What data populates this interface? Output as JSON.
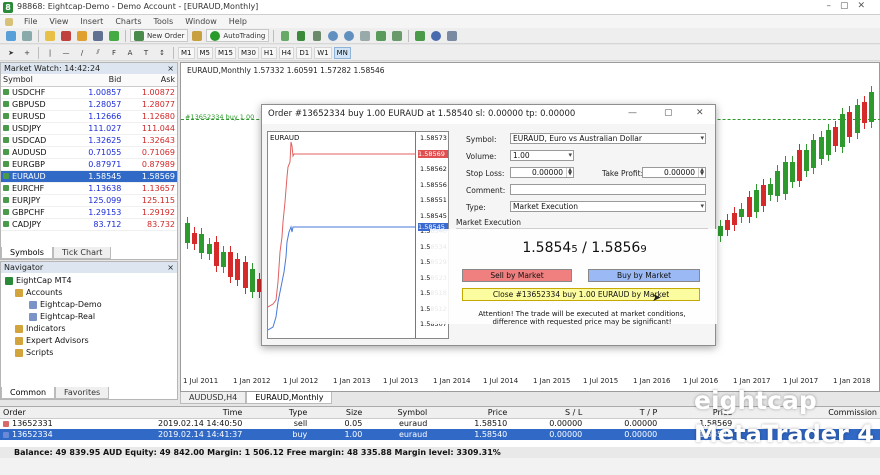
{
  "window": {
    "title": "98868: Eightcap-Demo - Demo Account - [EURAUD,Monthly]"
  },
  "menu": [
    "File",
    "View",
    "Insert",
    "Charts",
    "Tools",
    "Window",
    "Help"
  ],
  "toolbar": {
    "new_order": "New Order",
    "autotrading": "AutoTrading",
    "periods": [
      "M1",
      "M5",
      "M15",
      "M30",
      "H1",
      "H4",
      "D1",
      "W1",
      "MN"
    ],
    "active_period": "MN"
  },
  "market_watch": {
    "title": "Market Watch: 14:42:24",
    "columns": [
      "Symbol",
      "Bid",
      "Ask"
    ],
    "rows": [
      {
        "symbol": "USDCHF",
        "bid": "1.00857",
        "ask": "1.00872"
      },
      {
        "symbol": "GBPUSD",
        "bid": "1.28057",
        "ask": "1.28077"
      },
      {
        "symbol": "EURUSD",
        "bid": "1.12666",
        "ask": "1.12680"
      },
      {
        "symbol": "USDJPY",
        "bid": "111.027",
        "ask": "111.044"
      },
      {
        "symbol": "USDCAD",
        "bid": "1.32625",
        "ask": "1.32643"
      },
      {
        "symbol": "AUDUSD",
        "bid": "0.71055",
        "ask": "0.71069"
      },
      {
        "symbol": "EURGBP",
        "bid": "0.87971",
        "ask": "0.87989"
      },
      {
        "symbol": "EURAUD",
        "bid": "1.58545",
        "ask": "1.58569"
      },
      {
        "symbol": "EURCHF",
        "bid": "1.13638",
        "ask": "1.13657"
      },
      {
        "symbol": "EURJPY",
        "bid": "125.099",
        "ask": "125.115"
      },
      {
        "symbol": "GBPCHF",
        "bid": "1.29153",
        "ask": "1.29192"
      },
      {
        "symbol": "CADJPY",
        "bid": "83.712",
        "ask": "83.732"
      }
    ],
    "selected": "EURAUD",
    "tabs": [
      "Symbols",
      "Tick Chart"
    ]
  },
  "navigator": {
    "title": "Navigator",
    "root": "EightCap MT4",
    "accounts_label": "Accounts",
    "accounts": [
      "Eightcap-Demo",
      "Eightcap-Real"
    ],
    "folders": [
      "Indicators",
      "Expert Advisors",
      "Scripts"
    ],
    "tabs": [
      "Common",
      "Favorites"
    ]
  },
  "chart": {
    "header": "EURAUD,Monthly  1.57332 1.60591 1.57282 1.58546",
    "order_label": "#13652334 buy 1.00",
    "x_labels": [
      "1 Jul 2011",
      "1 Jan 2012",
      "1 Jul 2012",
      "1 Jan 2013",
      "1 Jul 2013",
      "1 Jan 2014",
      "1 Jul 2014",
      "1 Jan 2015",
      "1 Jul 2015",
      "1 Jan 2016",
      "1 Jul 2016",
      "1 Jan 2017",
      "1 Jul 2017",
      "1 Jan 2018"
    ],
    "tabs": [
      "AUDUSD,H4",
      "EURAUD,Monthly"
    ],
    "active_tab": "EURAUD,Monthly"
  },
  "order_dialog": {
    "title": "Order #13652334 buy 1.00 EURAUD at 1.58540 sl: 0.00000 tp: 0.00000",
    "tick_chart_symbol": "EURAUD",
    "tick_chart_prices": [
      "1.58573",
      "1.58569",
      "1.58562",
      "1.58556",
      "1.58551",
      "1.58545",
      "1.58540",
      "1.58534",
      "1.58529",
      "1.58523",
      "1.58518",
      "1.58512",
      "1.58507"
    ],
    "ask_tag": "1.58569",
    "bid_tag": "1.58545",
    "symbol_label": "Symbol:",
    "symbol_value": "EURAUD, Euro vs Australian Dollar",
    "volume_label": "Volume:",
    "volume_value": "1.00",
    "stoploss_label": "Stop Loss:",
    "stoploss_value": "0.00000",
    "takeprofit_label": "Take Profit:",
    "takeprofit_value": "0.00000",
    "comment_label": "Comment:",
    "comment_value": "",
    "type_label": "Type:",
    "type_value": "Market Execution",
    "section_label": "Market Execution",
    "bid_main": "1.5854",
    "bid_small": "5",
    "price_separator": " / ",
    "ask_main": "1.5856",
    "ask_small": "9",
    "sell_label": "Sell by Market",
    "buy_label": "Buy by Market",
    "close_label": "Close #13652334 buy 1.00 EURAUD by Market",
    "attention": "Attention! The trade will be executed at market conditions, difference with requested price may be significant!"
  },
  "orders": {
    "columns": [
      "Order",
      "Time",
      "Type",
      "Size",
      "Symbol",
      "Price",
      "S / L",
      "T / P",
      "Price",
      "Commission"
    ],
    "rows": [
      {
        "order": "13652331",
        "time": "2019.02.14 14:40:50",
        "type": "sell",
        "size": "0.05",
        "symbol": "euraud",
        "price": "1.58510",
        "sl": "0.00000",
        "tp": "0.00000",
        "price2": "1.58569",
        "commission": ""
      },
      {
        "order": "13652334",
        "time": "2019.02.14 14:41:37",
        "type": "buy",
        "size": "1.00",
        "symbol": "euraud",
        "price": "1.58540",
        "sl": "0.00000",
        "tp": "0.00000",
        "price2": "1.58545",
        "commission": ""
      }
    ],
    "balance": "Balance: 49 839.95 AUD  Equity: 49 842.00  Margin: 1 506.12  Free margin: 48 335.88  Margin level: 3309.31%"
  },
  "watermark": {
    "line1": "eightcap",
    "line2": "MetaTrader 4"
  },
  "colors": {
    "selection": "#3169c6",
    "bid": "#1a2bd6",
    "ask": "#d12727",
    "bull": "#2e9a2e",
    "bear": "#d62a2a",
    "sell_btn": "#f07f7f",
    "buy_btn": "#9bb9f4",
    "close_btn": "#fbfba0"
  }
}
